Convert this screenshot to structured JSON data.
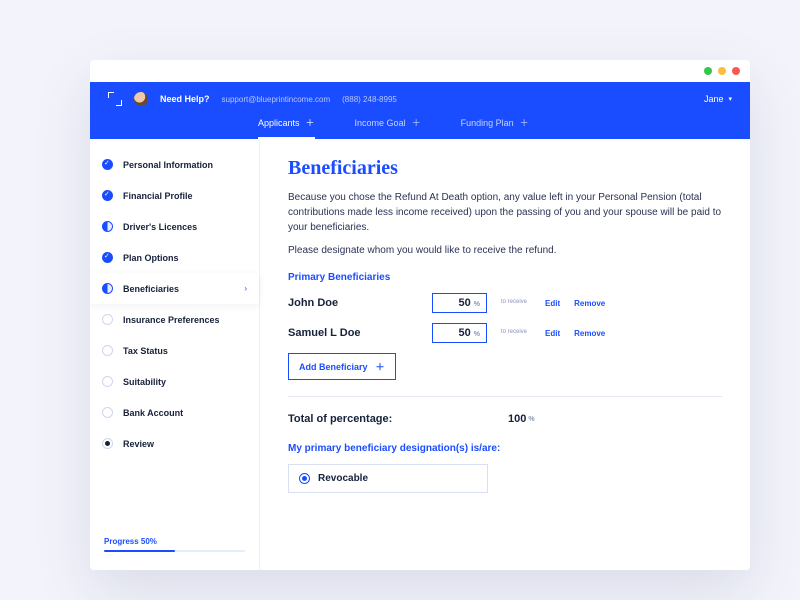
{
  "header": {
    "help_label": "Need Help?",
    "support_email": "support@blueprintincome.com",
    "phone": "(888) 248-8995",
    "user_name": "Jane"
  },
  "nav": [
    {
      "label": "Applicants",
      "active": true
    },
    {
      "label": "Income Goal",
      "active": false
    },
    {
      "label": "Funding Plan",
      "active": false
    }
  ],
  "sidebar": {
    "items": [
      {
        "label": "Personal Information",
        "state": "done"
      },
      {
        "label": "Financial Profile",
        "state": "done"
      },
      {
        "label": "Driver's Licences",
        "state": "half"
      },
      {
        "label": "Plan Options",
        "state": "done"
      },
      {
        "label": "Beneficiaries",
        "state": "half",
        "active": true
      },
      {
        "label": "Insurance Preferences",
        "state": "empty"
      },
      {
        "label": "Tax Status",
        "state": "empty"
      },
      {
        "label": "Suitability",
        "state": "empty"
      },
      {
        "label": "Bank Account",
        "state": "empty"
      },
      {
        "label": "Review",
        "state": "current"
      }
    ],
    "progress_label": "Progress 50%",
    "progress_pct": 50
  },
  "page": {
    "title": "Beneficiaries",
    "desc1": "Because you chose the Refund At Death option, any value left in your Personal Pension (total contributions made less income received) upon the passing of you and your spouse will be paid to your beneficiaries.",
    "desc2": "Please designate whom you would like to receive the refund.",
    "primary_heading": "Primary Beneficiaries",
    "beneficiaries": [
      {
        "name": "John Doe",
        "pct": "50"
      },
      {
        "name": "Samuel L Doe",
        "pct": "50"
      }
    ],
    "pct_unit": "%",
    "to_receive": "to receive",
    "edit_label": "Edit",
    "remove_label": "Remove",
    "add_label": "Add Beneficiary",
    "total_label": "Total of percentage:",
    "total_value": "100",
    "designation_label": "My primary beneficiary designation(s) is/are:",
    "radio_option": "Revocable"
  }
}
